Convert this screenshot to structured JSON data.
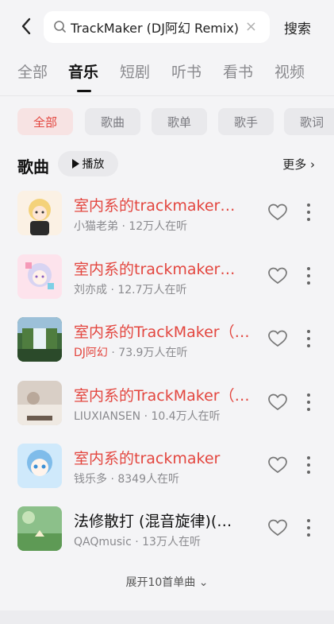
{
  "header": {
    "search_text": "TrackMaker (DJ阿幻 Remix)",
    "search_button": "搜索",
    "icons": [
      "back-arrow-icon",
      "search-icon",
      "clear-icon"
    ]
  },
  "tabs": [
    {
      "label": "全部",
      "active": false
    },
    {
      "label": "音乐",
      "active": true
    },
    {
      "label": "短剧",
      "active": false
    },
    {
      "label": "听书",
      "active": false
    },
    {
      "label": "看书",
      "active": false
    },
    {
      "label": "视频",
      "active": false
    }
  ],
  "chips": [
    {
      "label": "全部",
      "active": true
    },
    {
      "label": "歌曲",
      "active": false
    },
    {
      "label": "歌单",
      "active": false
    },
    {
      "label": "歌手",
      "active": false
    },
    {
      "label": "歌词",
      "active": false
    }
  ],
  "section": {
    "title": "歌曲",
    "play_label": "播放",
    "more_label": "更多"
  },
  "songs": [
    {
      "title": "室内系的trackmaker（翻唱）",
      "artist": "小猫老弟",
      "listeners": "12万人在听",
      "title_color": "red",
      "artist_color": "gray"
    },
    {
      "title": "室内系的trackmaker（翻唱）",
      "artist": "刘亦成",
      "listeners": "12.7万人在听",
      "title_color": "red",
      "artist_color": "gray"
    },
    {
      "title": "室内系的TrackMaker（DJ阿幻）",
      "artist": "DJ阿幻",
      "listeners": "73.9万人在听",
      "title_color": "red",
      "artist_color": "red"
    },
    {
      "title": "室内系的TrackMaker（翻唱）",
      "artist": "LIUXIANSEN",
      "listeners": "10.4万人在听",
      "title_color": "red",
      "artist_color": "gray"
    },
    {
      "title": "室内系的trackmaker",
      "artist": "钱乐多",
      "listeners": "8349人在听",
      "title_color": "red",
      "artist_color": "gray"
    },
    {
      "title": "法修散打 (混音旋律)(…",
      "artist": "QAQmusic",
      "listeners": "13万人在听",
      "title_color": "mixed",
      "artist_color": "gray"
    }
  ],
  "expand_label": "展开10首单曲",
  "colors": {
    "accent": "#e3463f",
    "bg": "#f4f4f6",
    "chip_bg": "#e9e9ec"
  }
}
